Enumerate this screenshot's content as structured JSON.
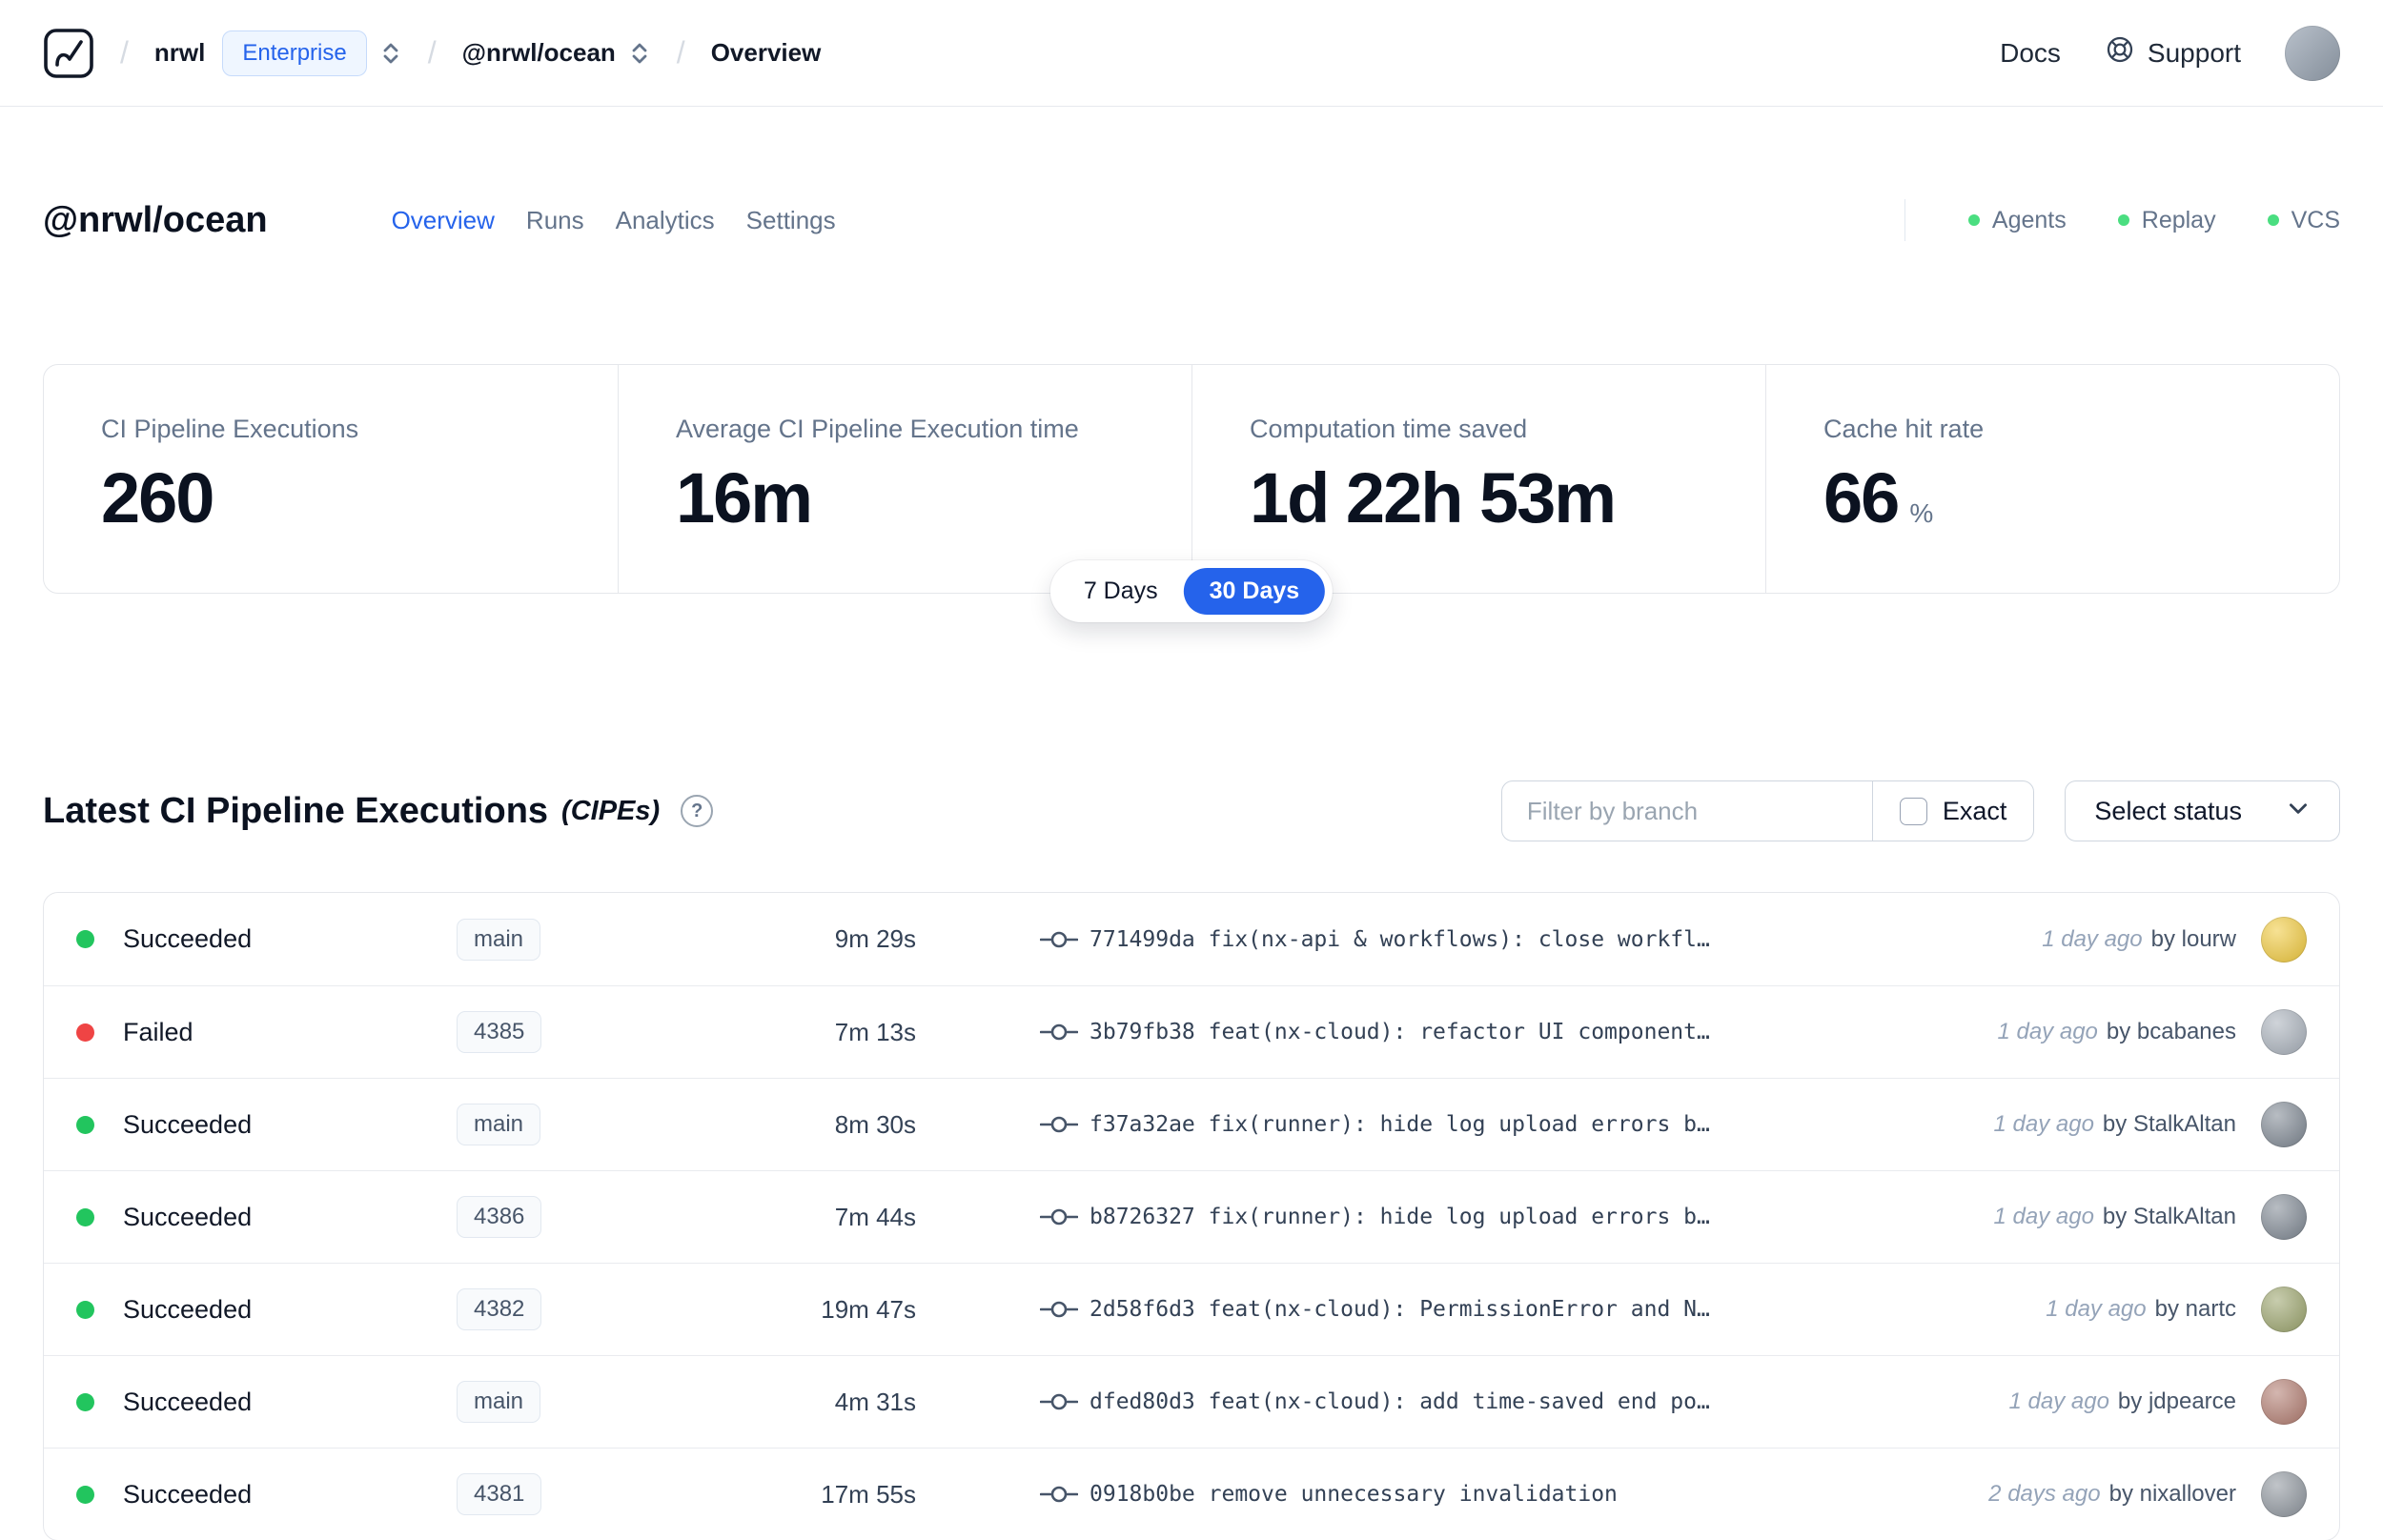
{
  "colors": {
    "accent_blue": "#2563eb",
    "succeeded": "#22c55e",
    "failed": "#ef4444",
    "integration_green": "#4ade80"
  },
  "navbar": {
    "separator": "/",
    "org": "nrwl",
    "org_badge": "Enterprise",
    "workspace": "@nrwl/ocean",
    "page": "Overview",
    "docs": "Docs",
    "support": "Support"
  },
  "workspace_header": {
    "title": "@nrwl/ocean",
    "tabs": [
      {
        "label": "Overview",
        "active": true
      },
      {
        "label": "Runs",
        "active": false
      },
      {
        "label": "Analytics",
        "active": false
      },
      {
        "label": "Settings",
        "active": false
      }
    ],
    "integrations": [
      {
        "label": "Agents"
      },
      {
        "label": "Replay"
      },
      {
        "label": "VCS"
      }
    ]
  },
  "stats": {
    "cards": [
      {
        "label": "CI Pipeline Executions",
        "value": "260"
      },
      {
        "label": "Average CI Pipeline Execution time",
        "value": "16m"
      },
      {
        "label": "Computation time saved",
        "value": "1d 22h 53m"
      },
      {
        "label": "Cache hit rate",
        "value": "66",
        "suffix": "%"
      }
    ],
    "range_toggle": {
      "options": [
        "7 Days",
        "30 Days"
      ],
      "selected": "30 Days"
    }
  },
  "cipes": {
    "title": "Latest CI Pipeline Executions",
    "title_suffix": "(CIPEs)",
    "help_icon": "?",
    "filter_placeholder": "Filter by branch",
    "exact_label": "Exact",
    "exact_checked": false,
    "status_dropdown_label": "Select status",
    "rows": [
      {
        "status": "Succeeded",
        "branch": "main",
        "duration": "9m 29s",
        "commit": "771499da",
        "message": "fix(nx-api & workflows): close workfl…",
        "time": "1 day ago",
        "author": "by lourw",
        "avatar_color": "#f0c93c"
      },
      {
        "status": "Failed",
        "branch": "4385",
        "duration": "7m 13s",
        "commit": "3b79fb38",
        "message": "feat(nx-cloud): refactor UI component…",
        "time": "1 day ago",
        "author": "by bcabanes",
        "avatar_color": "#a8b0ba"
      },
      {
        "status": "Succeeded",
        "branch": "main",
        "duration": "8m 30s",
        "commit": "f37a32ae",
        "message": "fix(runner): hide log upload errors b…",
        "time": "1 day ago",
        "author": "by StalkAltan",
        "avatar_color": "#7d8691"
      },
      {
        "status": "Succeeded",
        "branch": "4386",
        "duration": "7m 44s",
        "commit": "b8726327",
        "message": "fix(runner): hide log upload errors b…",
        "time": "1 day ago",
        "author": "by StalkAltan",
        "avatar_color": "#7d8691"
      },
      {
        "status": "Succeeded",
        "branch": "4382",
        "duration": "19m 47s",
        "commit": "2d58f6d3",
        "message": "feat(nx-cloud): PermissionError and N…",
        "time": "1 day ago",
        "author": "by nartc",
        "avatar_color": "#9aa36b"
      },
      {
        "status": "Succeeded",
        "branch": "main",
        "duration": "4m 31s",
        "commit": "dfed80d3",
        "message": "feat(nx-cloud): add time-saved end po…",
        "time": "1 day ago",
        "author": "by jdpearce",
        "avatar_color": "#b07a6e"
      },
      {
        "status": "Succeeded",
        "branch": "4381",
        "duration": "17m 55s",
        "commit": "0918b0be",
        "message": "remove unnecessary invalidation",
        "time": "2 days ago",
        "author": "by nixallover",
        "avatar_color": "#8d949c"
      }
    ]
  }
}
